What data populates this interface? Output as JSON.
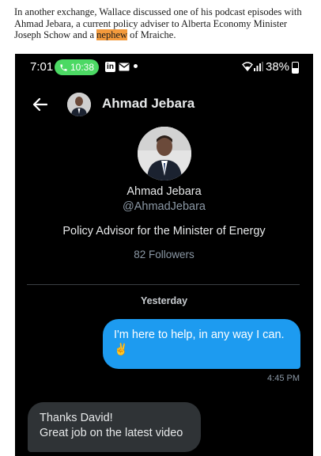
{
  "article": {
    "text_before": "In another exchange, Wallace discussed one of his podcast episodes with Ahmad Jebara, a current policy adviser to Alberta Economy Minister Joseph Schow and a ",
    "highlight": "nephew",
    "text_after": " of Mraiche.",
    "highlight_color": "#f39a3c"
  },
  "status_bar": {
    "time": "7:01",
    "call_duration": "10:38",
    "linkedin_icon": "in",
    "mail_icon": "mail-icon",
    "battery": "38%"
  },
  "conversation": {
    "header_name": "Ahmad Jebara",
    "profile": {
      "name": "Ahmad Jebara",
      "handle": "@AhmadJebara",
      "bio": "Policy Advisor for the Minister of Energy",
      "followers": "82 Followers"
    },
    "date_separator": "Yesterday",
    "messages": [
      {
        "direction": "sent",
        "lines": [
          "I'm here to help, in any way I can.",
          "✌️"
        ],
        "time": "4:45 PM"
      },
      {
        "direction": "received",
        "lines": [
          "Thanks David!",
          "Great job on the latest video"
        ]
      }
    ]
  },
  "colors": {
    "background": "#000000",
    "sent_bubble": "#1d9bf0",
    "received_bubble": "#2f3336",
    "call_pill": "#4cd964"
  }
}
